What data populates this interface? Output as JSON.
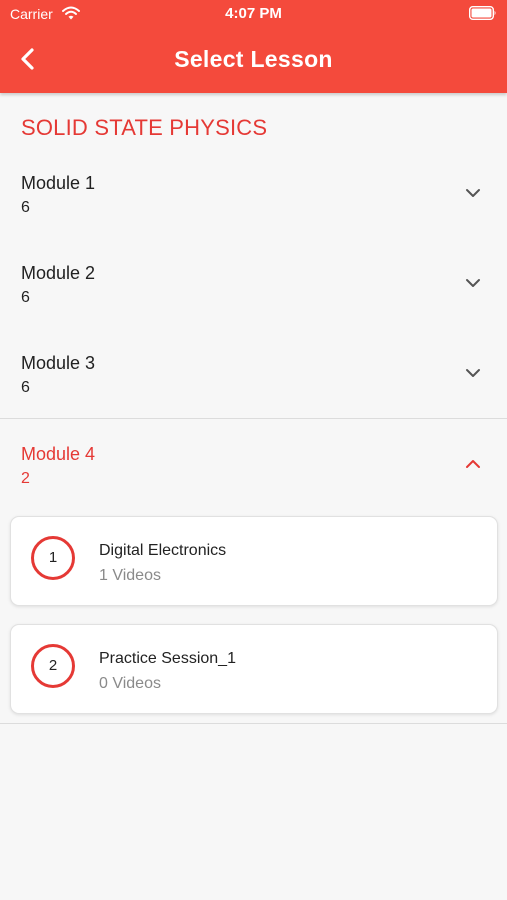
{
  "status": {
    "carrier": "Carrier",
    "time": "4:07 PM"
  },
  "header": {
    "title": "Select Lesson",
    "back_icon": "chevron-left-icon",
    "background": "#f44a3c"
  },
  "course": {
    "title": "SOLID STATE PHYSICS",
    "accent": "#e53935"
  },
  "modules": [
    {
      "name": "Module 1",
      "count": "6",
      "expanded": false
    },
    {
      "name": "Module 2",
      "count": "6",
      "expanded": false
    },
    {
      "name": "Module 3",
      "count": "6",
      "expanded": false
    },
    {
      "name": "Module 4",
      "count": "2",
      "expanded": true,
      "lessons": [
        {
          "number": "1",
          "title": "Digital Electronics",
          "videos": "1 Videos"
        },
        {
          "number": "2",
          "title": "Practice Session_1",
          "videos": "0 Videos"
        }
      ]
    }
  ]
}
